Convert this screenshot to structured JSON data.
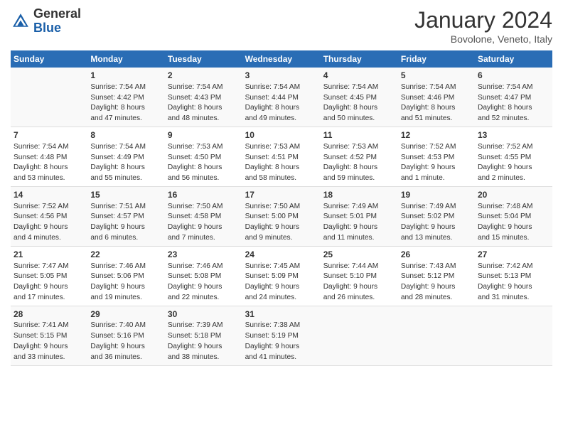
{
  "logo": {
    "general": "General",
    "blue": "Blue"
  },
  "header": {
    "month": "January 2024",
    "location": "Bovolone, Veneto, Italy"
  },
  "days_of_week": [
    "Sunday",
    "Monday",
    "Tuesday",
    "Wednesday",
    "Thursday",
    "Friday",
    "Saturday"
  ],
  "weeks": [
    [
      {
        "day": "",
        "info": ""
      },
      {
        "day": "1",
        "info": "Sunrise: 7:54 AM\nSunset: 4:42 PM\nDaylight: 8 hours\nand 47 minutes."
      },
      {
        "day": "2",
        "info": "Sunrise: 7:54 AM\nSunset: 4:43 PM\nDaylight: 8 hours\nand 48 minutes."
      },
      {
        "day": "3",
        "info": "Sunrise: 7:54 AM\nSunset: 4:44 PM\nDaylight: 8 hours\nand 49 minutes."
      },
      {
        "day": "4",
        "info": "Sunrise: 7:54 AM\nSunset: 4:45 PM\nDaylight: 8 hours\nand 50 minutes."
      },
      {
        "day": "5",
        "info": "Sunrise: 7:54 AM\nSunset: 4:46 PM\nDaylight: 8 hours\nand 51 minutes."
      },
      {
        "day": "6",
        "info": "Sunrise: 7:54 AM\nSunset: 4:47 PM\nDaylight: 8 hours\nand 52 minutes."
      }
    ],
    [
      {
        "day": "7",
        "info": "Sunrise: 7:54 AM\nSunset: 4:48 PM\nDaylight: 8 hours\nand 53 minutes."
      },
      {
        "day": "8",
        "info": "Sunrise: 7:54 AM\nSunset: 4:49 PM\nDaylight: 8 hours\nand 55 minutes."
      },
      {
        "day": "9",
        "info": "Sunrise: 7:53 AM\nSunset: 4:50 PM\nDaylight: 8 hours\nand 56 minutes."
      },
      {
        "day": "10",
        "info": "Sunrise: 7:53 AM\nSunset: 4:51 PM\nDaylight: 8 hours\nand 58 minutes."
      },
      {
        "day": "11",
        "info": "Sunrise: 7:53 AM\nSunset: 4:52 PM\nDaylight: 8 hours\nand 59 minutes."
      },
      {
        "day": "12",
        "info": "Sunrise: 7:52 AM\nSunset: 4:53 PM\nDaylight: 9 hours\nand 1 minute."
      },
      {
        "day": "13",
        "info": "Sunrise: 7:52 AM\nSunset: 4:55 PM\nDaylight: 9 hours\nand 2 minutes."
      }
    ],
    [
      {
        "day": "14",
        "info": "Sunrise: 7:52 AM\nSunset: 4:56 PM\nDaylight: 9 hours\nand 4 minutes."
      },
      {
        "day": "15",
        "info": "Sunrise: 7:51 AM\nSunset: 4:57 PM\nDaylight: 9 hours\nand 6 minutes."
      },
      {
        "day": "16",
        "info": "Sunrise: 7:50 AM\nSunset: 4:58 PM\nDaylight: 9 hours\nand 7 minutes."
      },
      {
        "day": "17",
        "info": "Sunrise: 7:50 AM\nSunset: 5:00 PM\nDaylight: 9 hours\nand 9 minutes."
      },
      {
        "day": "18",
        "info": "Sunrise: 7:49 AM\nSunset: 5:01 PM\nDaylight: 9 hours\nand 11 minutes."
      },
      {
        "day": "19",
        "info": "Sunrise: 7:49 AM\nSunset: 5:02 PM\nDaylight: 9 hours\nand 13 minutes."
      },
      {
        "day": "20",
        "info": "Sunrise: 7:48 AM\nSunset: 5:04 PM\nDaylight: 9 hours\nand 15 minutes."
      }
    ],
    [
      {
        "day": "21",
        "info": "Sunrise: 7:47 AM\nSunset: 5:05 PM\nDaylight: 9 hours\nand 17 minutes."
      },
      {
        "day": "22",
        "info": "Sunrise: 7:46 AM\nSunset: 5:06 PM\nDaylight: 9 hours\nand 19 minutes."
      },
      {
        "day": "23",
        "info": "Sunrise: 7:46 AM\nSunset: 5:08 PM\nDaylight: 9 hours\nand 22 minutes."
      },
      {
        "day": "24",
        "info": "Sunrise: 7:45 AM\nSunset: 5:09 PM\nDaylight: 9 hours\nand 24 minutes."
      },
      {
        "day": "25",
        "info": "Sunrise: 7:44 AM\nSunset: 5:10 PM\nDaylight: 9 hours\nand 26 minutes."
      },
      {
        "day": "26",
        "info": "Sunrise: 7:43 AM\nSunset: 5:12 PM\nDaylight: 9 hours\nand 28 minutes."
      },
      {
        "day": "27",
        "info": "Sunrise: 7:42 AM\nSunset: 5:13 PM\nDaylight: 9 hours\nand 31 minutes."
      }
    ],
    [
      {
        "day": "28",
        "info": "Sunrise: 7:41 AM\nSunset: 5:15 PM\nDaylight: 9 hours\nand 33 minutes."
      },
      {
        "day": "29",
        "info": "Sunrise: 7:40 AM\nSunset: 5:16 PM\nDaylight: 9 hours\nand 36 minutes."
      },
      {
        "day": "30",
        "info": "Sunrise: 7:39 AM\nSunset: 5:18 PM\nDaylight: 9 hours\nand 38 minutes."
      },
      {
        "day": "31",
        "info": "Sunrise: 7:38 AM\nSunset: 5:19 PM\nDaylight: 9 hours\nand 41 minutes."
      },
      {
        "day": "",
        "info": ""
      },
      {
        "day": "",
        "info": ""
      },
      {
        "day": "",
        "info": ""
      }
    ]
  ]
}
